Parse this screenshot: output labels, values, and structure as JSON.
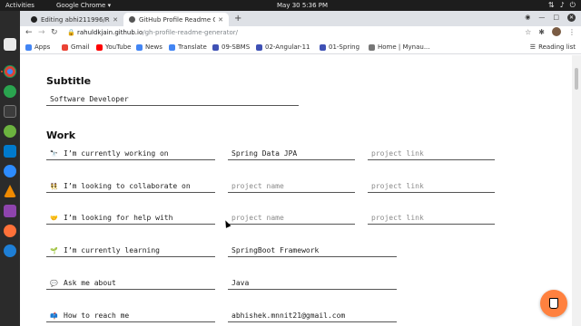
{
  "topbar": {
    "activities": "Activities",
    "app_menu": "Google Chrome ▾",
    "clock": "May 30   5:36 PM",
    "icons": [
      "network-icon",
      "volume-icon",
      "power-icon"
    ]
  },
  "dock": {
    "items": [
      "files-icon",
      "chrome-icon",
      "vscode-icon",
      "terminal-icon",
      "spring-icon",
      "zoom-icon",
      "vlc-icon",
      "firefox-icon",
      "settings-icon"
    ]
  },
  "browser": {
    "tabs": [
      {
        "title": "Editing abhi211996/READ",
        "active": false
      },
      {
        "title": "GitHub Profile Readme G",
        "active": true
      }
    ],
    "url_host": "rahuldkjain.github.io",
    "url_path": "/gh-profile-readme-generator/",
    "bookmarks": [
      {
        "label": "Apps",
        "icon": "apps-grid-icon"
      },
      {
        "label": "Gmail",
        "icon": "gmail-icon"
      },
      {
        "label": "YouTube",
        "icon": "youtube-icon"
      },
      {
        "label": "News",
        "icon": "news-icon"
      },
      {
        "label": "Translate",
        "icon": "translate-icon"
      },
      {
        "label": "09-SBMS",
        "icon": "bookmark-icon"
      },
      {
        "label": "02-Angular-11",
        "icon": "bookmark-icon"
      },
      {
        "label": "01-Spring",
        "icon": "bookmark-icon"
      },
      {
        "label": "Home | Mynau...",
        "icon": "bookmark-icon"
      }
    ],
    "reading_list": "Reading list"
  },
  "form": {
    "subtitle_heading": "Subtitle",
    "subtitle_value": "Software Developer",
    "work_heading": "Work",
    "rows": [
      {
        "emoji": "🔭",
        "prefix": "I’m currently working on",
        "value": "Spring Data JPA",
        "value_placeholder": "project name",
        "link": "",
        "link_placeholder": "project link"
      },
      {
        "emoji": "👯",
        "prefix": "I’m looking to collaborate on",
        "value": "",
        "value_placeholder": "project name",
        "link": "",
        "link_placeholder": "project link"
      },
      {
        "emoji": "🤝",
        "prefix": "I’m looking for help with",
        "value": "",
        "value_placeholder": "project name",
        "link": "",
        "link_placeholder": "project link"
      },
      {
        "emoji": "🌱",
        "prefix": "I’m currently learning",
        "value": "SpringBoot Framework"
      },
      {
        "emoji": "💬",
        "prefix": "Ask me about",
        "value": "Java"
      },
      {
        "emoji": "📫",
        "prefix": "How to reach me",
        "value": "abhishek.mnnit21@gmail.com"
      }
    ]
  },
  "colors": {
    "accent_coffee": "#ff813f",
    "ubuntu_orange": "#e95420",
    "chrome_frame": "#dee1e6"
  }
}
